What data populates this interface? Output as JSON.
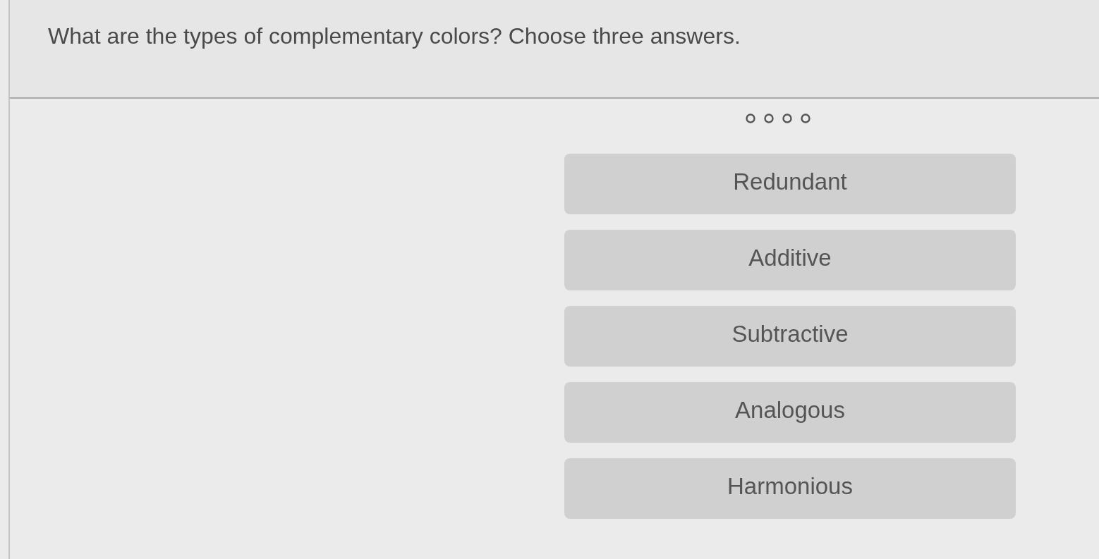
{
  "question": {
    "text": "What are the types of complementary colors? Choose three answers."
  },
  "progress_dots": [
    {
      "filled": false
    },
    {
      "filled": false
    },
    {
      "filled": false
    },
    {
      "filled": false
    }
  ],
  "options": [
    {
      "label": "Redundant",
      "selected": false
    },
    {
      "label": "Additive",
      "selected": false
    },
    {
      "label": "Subtractive",
      "selected": false
    },
    {
      "label": "Analogous",
      "selected": false
    },
    {
      "label": "Harmonious",
      "selected": false
    }
  ]
}
